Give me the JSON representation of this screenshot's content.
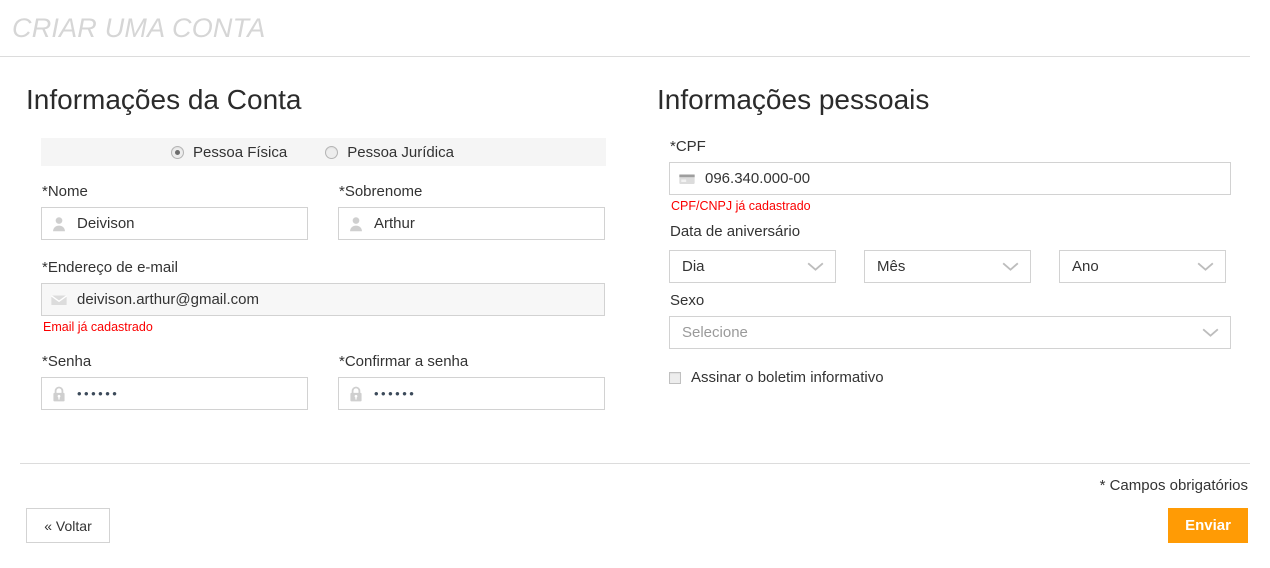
{
  "page": {
    "title": "CRIAR UMA CONTA"
  },
  "account_section": {
    "heading": "Informações da Conta",
    "person_type": {
      "options": [
        {
          "label": "Pessoa Física",
          "selected": true
        },
        {
          "label": "Pessoa Jurídica",
          "selected": false
        }
      ]
    },
    "fields": {
      "first_name": {
        "label": "*Nome",
        "value": "Deivison",
        "icon": "user-icon"
      },
      "last_name": {
        "label": "*Sobrenome",
        "value": "Arthur",
        "icon": "user-icon"
      },
      "email": {
        "label": "*Endereço de e-mail",
        "value": "deivison.arthur@gmail.com",
        "icon": "envelope-icon",
        "error": "Email já cadastrado"
      },
      "password": {
        "label": "*Senha",
        "value": "••••••",
        "icon": "lock-icon"
      },
      "password_confirm": {
        "label": "*Confirmar a senha",
        "value": "••••••",
        "icon": "lock-icon"
      }
    }
  },
  "personal_section": {
    "heading": "Informações pessoais",
    "cpf": {
      "label": "*CPF",
      "value": "096.340.000-00",
      "icon": "card-icon",
      "error": "CPF/CNPJ já cadastrado"
    },
    "birthday": {
      "label": "Data de aniversário",
      "day": {
        "value": "Dia"
      },
      "month": {
        "value": "Mês"
      },
      "year": {
        "value": "Ano"
      }
    },
    "gender": {
      "label": "Sexo",
      "value": "Selecione",
      "is_placeholder": true
    },
    "newsletter": {
      "label": "Assinar o boletim informativo",
      "checked": false
    }
  },
  "footer": {
    "required_note": "* Campos obrigatórios",
    "back_label": "« Voltar",
    "submit_label": "Enviar"
  },
  "colors": {
    "accent_orange": "#ff9b05",
    "error_red": "#fb0000",
    "title_gray": "#d6d6d6",
    "border_gray": "#d2d2d2",
    "radio_bar_bg": "#f5f5f5"
  }
}
